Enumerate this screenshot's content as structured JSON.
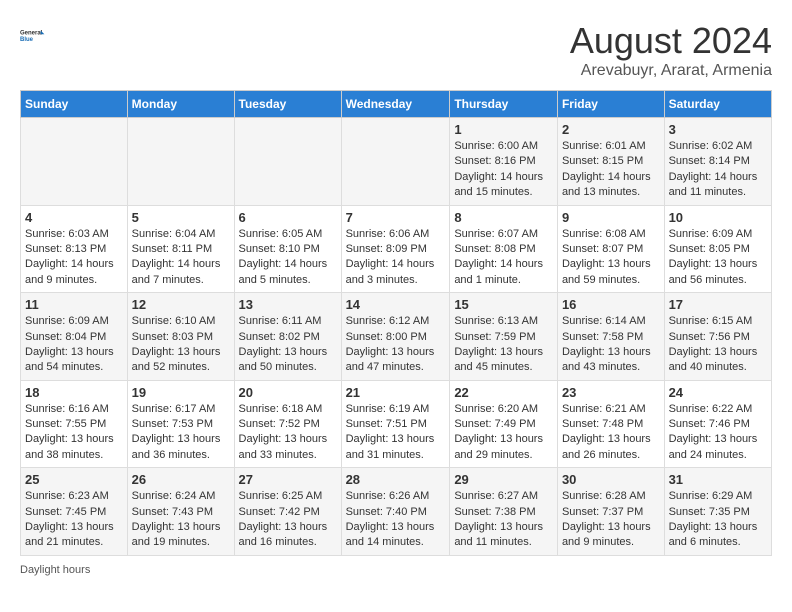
{
  "header": {
    "logo_line1": "General",
    "logo_line2": "Blue",
    "main_title": "August 2024",
    "subtitle": "Arevabuyr, Ararat, Armenia"
  },
  "days_of_week": [
    "Sunday",
    "Monday",
    "Tuesday",
    "Wednesday",
    "Thursday",
    "Friday",
    "Saturday"
  ],
  "weeks": [
    [
      {
        "day": "",
        "info": ""
      },
      {
        "day": "",
        "info": ""
      },
      {
        "day": "",
        "info": ""
      },
      {
        "day": "",
        "info": ""
      },
      {
        "day": "1",
        "info": "Sunrise: 6:00 AM\nSunset: 8:16 PM\nDaylight: 14 hours and 15 minutes."
      },
      {
        "day": "2",
        "info": "Sunrise: 6:01 AM\nSunset: 8:15 PM\nDaylight: 14 hours and 13 minutes."
      },
      {
        "day": "3",
        "info": "Sunrise: 6:02 AM\nSunset: 8:14 PM\nDaylight: 14 hours and 11 minutes."
      }
    ],
    [
      {
        "day": "4",
        "info": "Sunrise: 6:03 AM\nSunset: 8:13 PM\nDaylight: 14 hours and 9 minutes."
      },
      {
        "day": "5",
        "info": "Sunrise: 6:04 AM\nSunset: 8:11 PM\nDaylight: 14 hours and 7 minutes."
      },
      {
        "day": "6",
        "info": "Sunrise: 6:05 AM\nSunset: 8:10 PM\nDaylight: 14 hours and 5 minutes."
      },
      {
        "day": "7",
        "info": "Sunrise: 6:06 AM\nSunset: 8:09 PM\nDaylight: 14 hours and 3 minutes."
      },
      {
        "day": "8",
        "info": "Sunrise: 6:07 AM\nSunset: 8:08 PM\nDaylight: 14 hours and 1 minute."
      },
      {
        "day": "9",
        "info": "Sunrise: 6:08 AM\nSunset: 8:07 PM\nDaylight: 13 hours and 59 minutes."
      },
      {
        "day": "10",
        "info": "Sunrise: 6:09 AM\nSunset: 8:05 PM\nDaylight: 13 hours and 56 minutes."
      }
    ],
    [
      {
        "day": "11",
        "info": "Sunrise: 6:09 AM\nSunset: 8:04 PM\nDaylight: 13 hours and 54 minutes."
      },
      {
        "day": "12",
        "info": "Sunrise: 6:10 AM\nSunset: 8:03 PM\nDaylight: 13 hours and 52 minutes."
      },
      {
        "day": "13",
        "info": "Sunrise: 6:11 AM\nSunset: 8:02 PM\nDaylight: 13 hours and 50 minutes."
      },
      {
        "day": "14",
        "info": "Sunrise: 6:12 AM\nSunset: 8:00 PM\nDaylight: 13 hours and 47 minutes."
      },
      {
        "day": "15",
        "info": "Sunrise: 6:13 AM\nSunset: 7:59 PM\nDaylight: 13 hours and 45 minutes."
      },
      {
        "day": "16",
        "info": "Sunrise: 6:14 AM\nSunset: 7:58 PM\nDaylight: 13 hours and 43 minutes."
      },
      {
        "day": "17",
        "info": "Sunrise: 6:15 AM\nSunset: 7:56 PM\nDaylight: 13 hours and 40 minutes."
      }
    ],
    [
      {
        "day": "18",
        "info": "Sunrise: 6:16 AM\nSunset: 7:55 PM\nDaylight: 13 hours and 38 minutes."
      },
      {
        "day": "19",
        "info": "Sunrise: 6:17 AM\nSunset: 7:53 PM\nDaylight: 13 hours and 36 minutes."
      },
      {
        "day": "20",
        "info": "Sunrise: 6:18 AM\nSunset: 7:52 PM\nDaylight: 13 hours and 33 minutes."
      },
      {
        "day": "21",
        "info": "Sunrise: 6:19 AM\nSunset: 7:51 PM\nDaylight: 13 hours and 31 minutes."
      },
      {
        "day": "22",
        "info": "Sunrise: 6:20 AM\nSunset: 7:49 PM\nDaylight: 13 hours and 29 minutes."
      },
      {
        "day": "23",
        "info": "Sunrise: 6:21 AM\nSunset: 7:48 PM\nDaylight: 13 hours and 26 minutes."
      },
      {
        "day": "24",
        "info": "Sunrise: 6:22 AM\nSunset: 7:46 PM\nDaylight: 13 hours and 24 minutes."
      }
    ],
    [
      {
        "day": "25",
        "info": "Sunrise: 6:23 AM\nSunset: 7:45 PM\nDaylight: 13 hours and 21 minutes."
      },
      {
        "day": "26",
        "info": "Sunrise: 6:24 AM\nSunset: 7:43 PM\nDaylight: 13 hours and 19 minutes."
      },
      {
        "day": "27",
        "info": "Sunrise: 6:25 AM\nSunset: 7:42 PM\nDaylight: 13 hours and 16 minutes."
      },
      {
        "day": "28",
        "info": "Sunrise: 6:26 AM\nSunset: 7:40 PM\nDaylight: 13 hours and 14 minutes."
      },
      {
        "day": "29",
        "info": "Sunrise: 6:27 AM\nSunset: 7:38 PM\nDaylight: 13 hours and 11 minutes."
      },
      {
        "day": "30",
        "info": "Sunrise: 6:28 AM\nSunset: 7:37 PM\nDaylight: 13 hours and 9 minutes."
      },
      {
        "day": "31",
        "info": "Sunrise: 6:29 AM\nSunset: 7:35 PM\nDaylight: 13 hours and 6 minutes."
      }
    ]
  ],
  "footer": "Daylight hours"
}
